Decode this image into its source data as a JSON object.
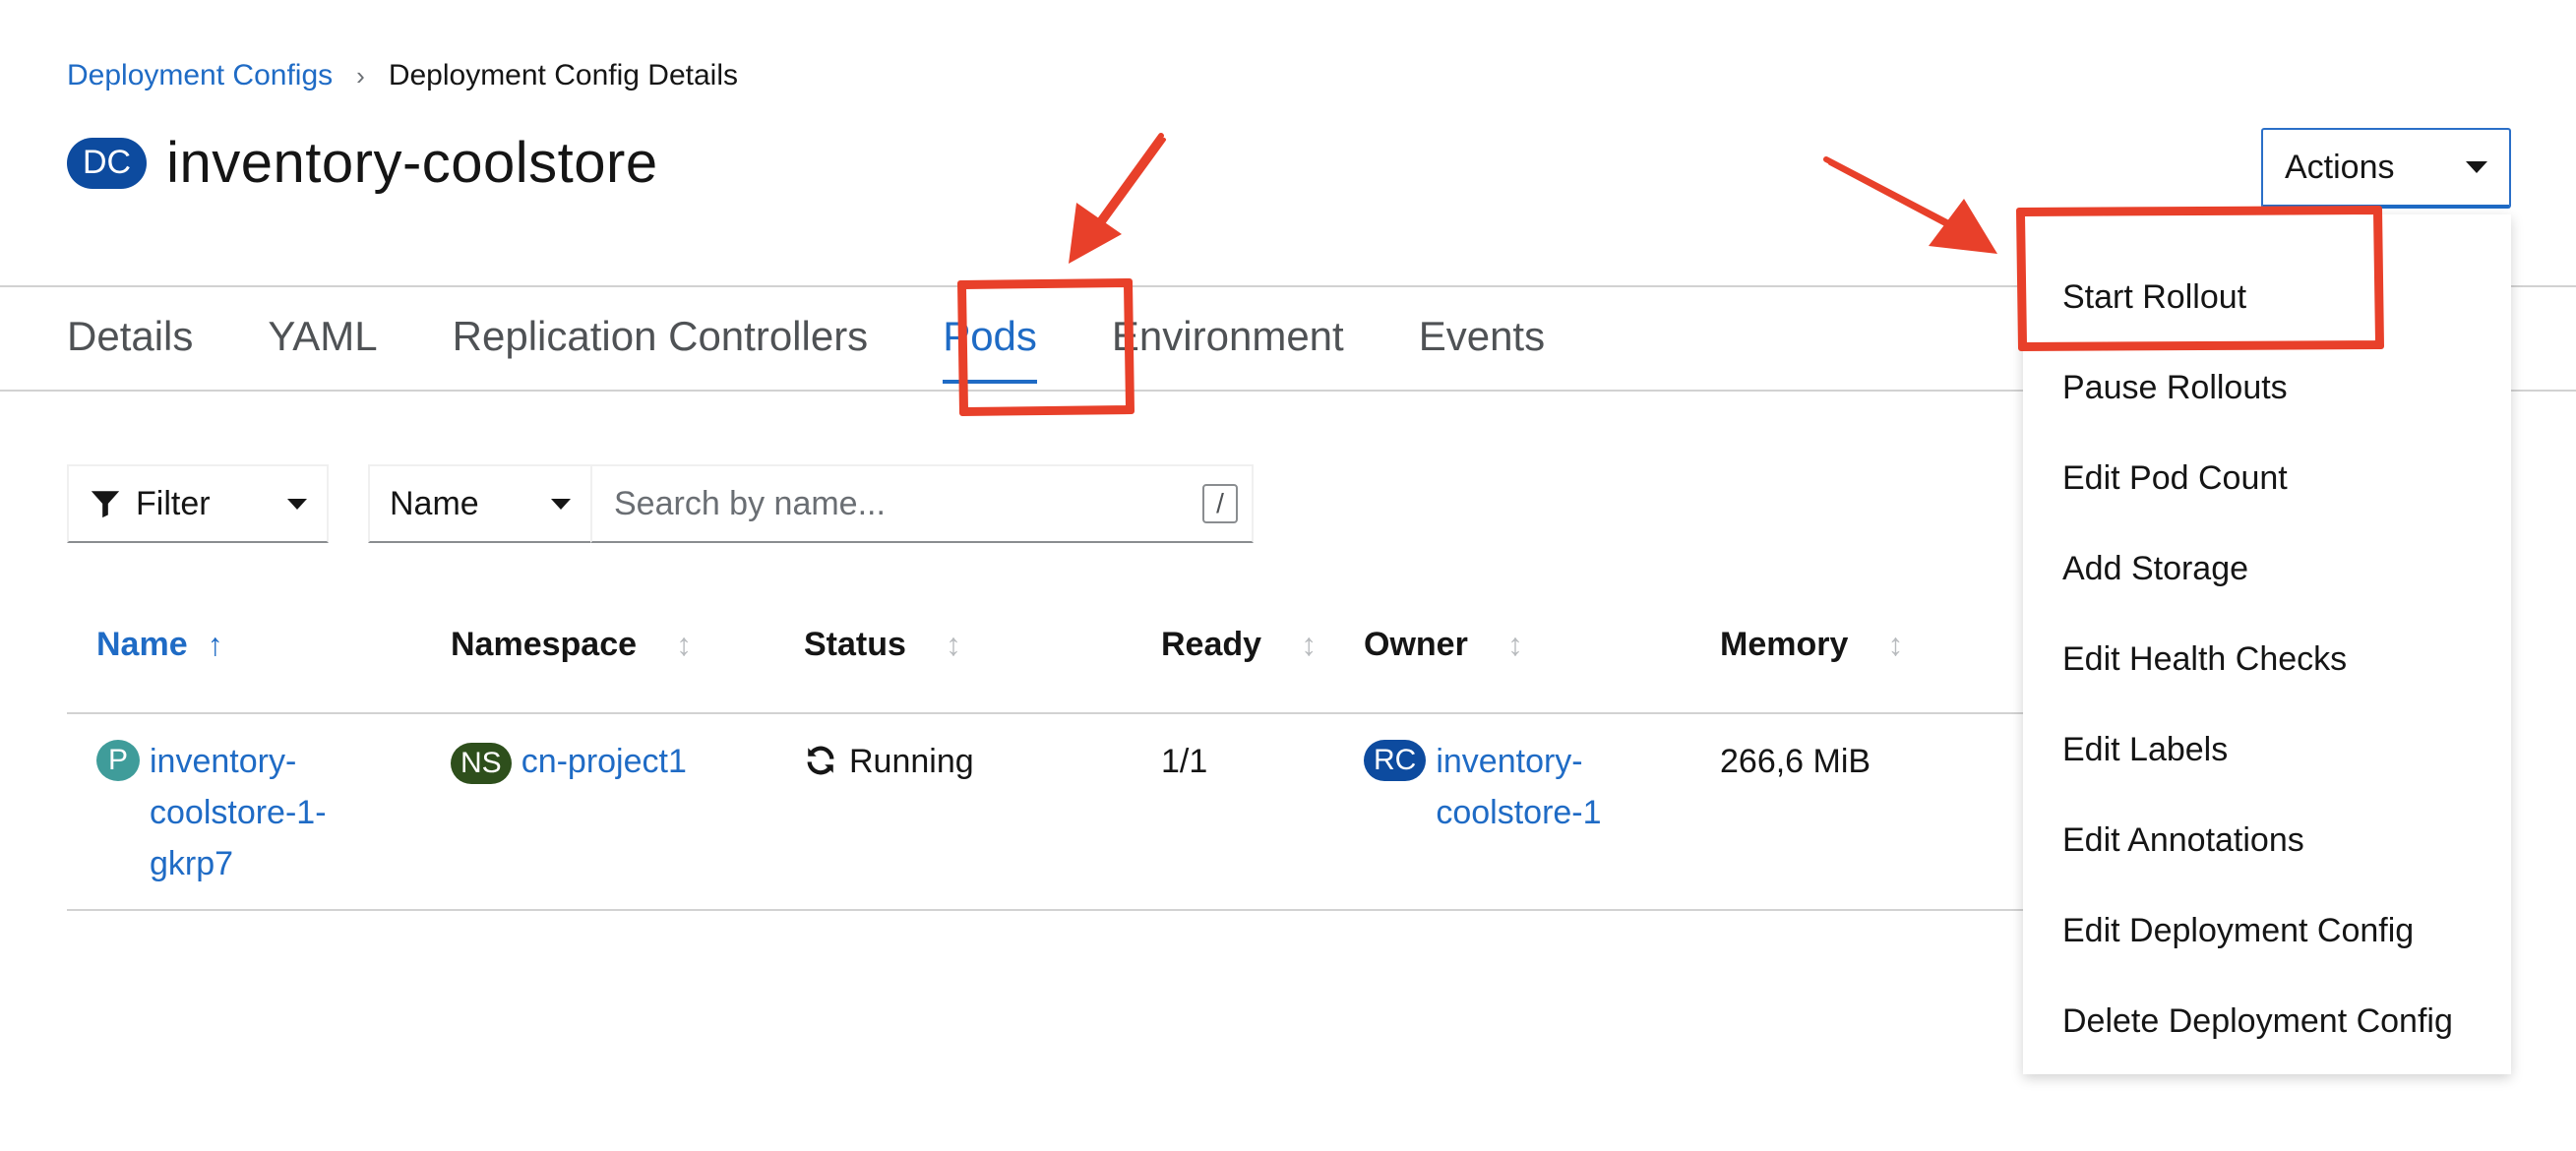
{
  "breadcrumb": {
    "parent": "Deployment Configs",
    "current": "Deployment Config Details"
  },
  "header": {
    "badge": "DC",
    "title": "inventory-coolstore",
    "actions_label": "Actions"
  },
  "tabs": [
    {
      "label": "Details"
    },
    {
      "label": "YAML"
    },
    {
      "label": "Replication Controllers"
    },
    {
      "label": "Pods",
      "active": true
    },
    {
      "label": "Environment"
    },
    {
      "label": "Events"
    }
  ],
  "toolbar": {
    "filter_label": "Filter",
    "name_select": "Name",
    "search_placeholder": "Search by name...",
    "search_shortcut": "/"
  },
  "table": {
    "columns": [
      "Name",
      "Namespace",
      "Status",
      "Ready",
      "Owner",
      "Memory"
    ],
    "sort_icon_active": "↑",
    "sort_icon": "↕",
    "rows": [
      {
        "name_badge": "P",
        "name_lines": [
          "inventory-",
          "coolstore-1-",
          "gkrp7"
        ],
        "namespace_badge": "NS",
        "namespace": "cn-project1",
        "status": "Running",
        "ready": "1/1",
        "owner_badge": "RC",
        "owner_lines": [
          "inventory-",
          "coolstore-1"
        ],
        "memory": "266,6 MiB"
      }
    ]
  },
  "actions_menu": {
    "items": [
      "Start Rollout",
      "Pause Rollouts",
      "Edit Pod Count",
      "Add Storage",
      "Edit Health Checks",
      "Edit Labels",
      "Edit Annotations",
      "Edit Deployment Config",
      "Delete Deployment Config"
    ]
  },
  "colors": {
    "link": "#1f6bc5",
    "annotation": "#e8402a",
    "badge_dc": "#0d4b9f",
    "badge_pod": "#3f9c9a",
    "badge_ns": "#2e4f1c"
  }
}
